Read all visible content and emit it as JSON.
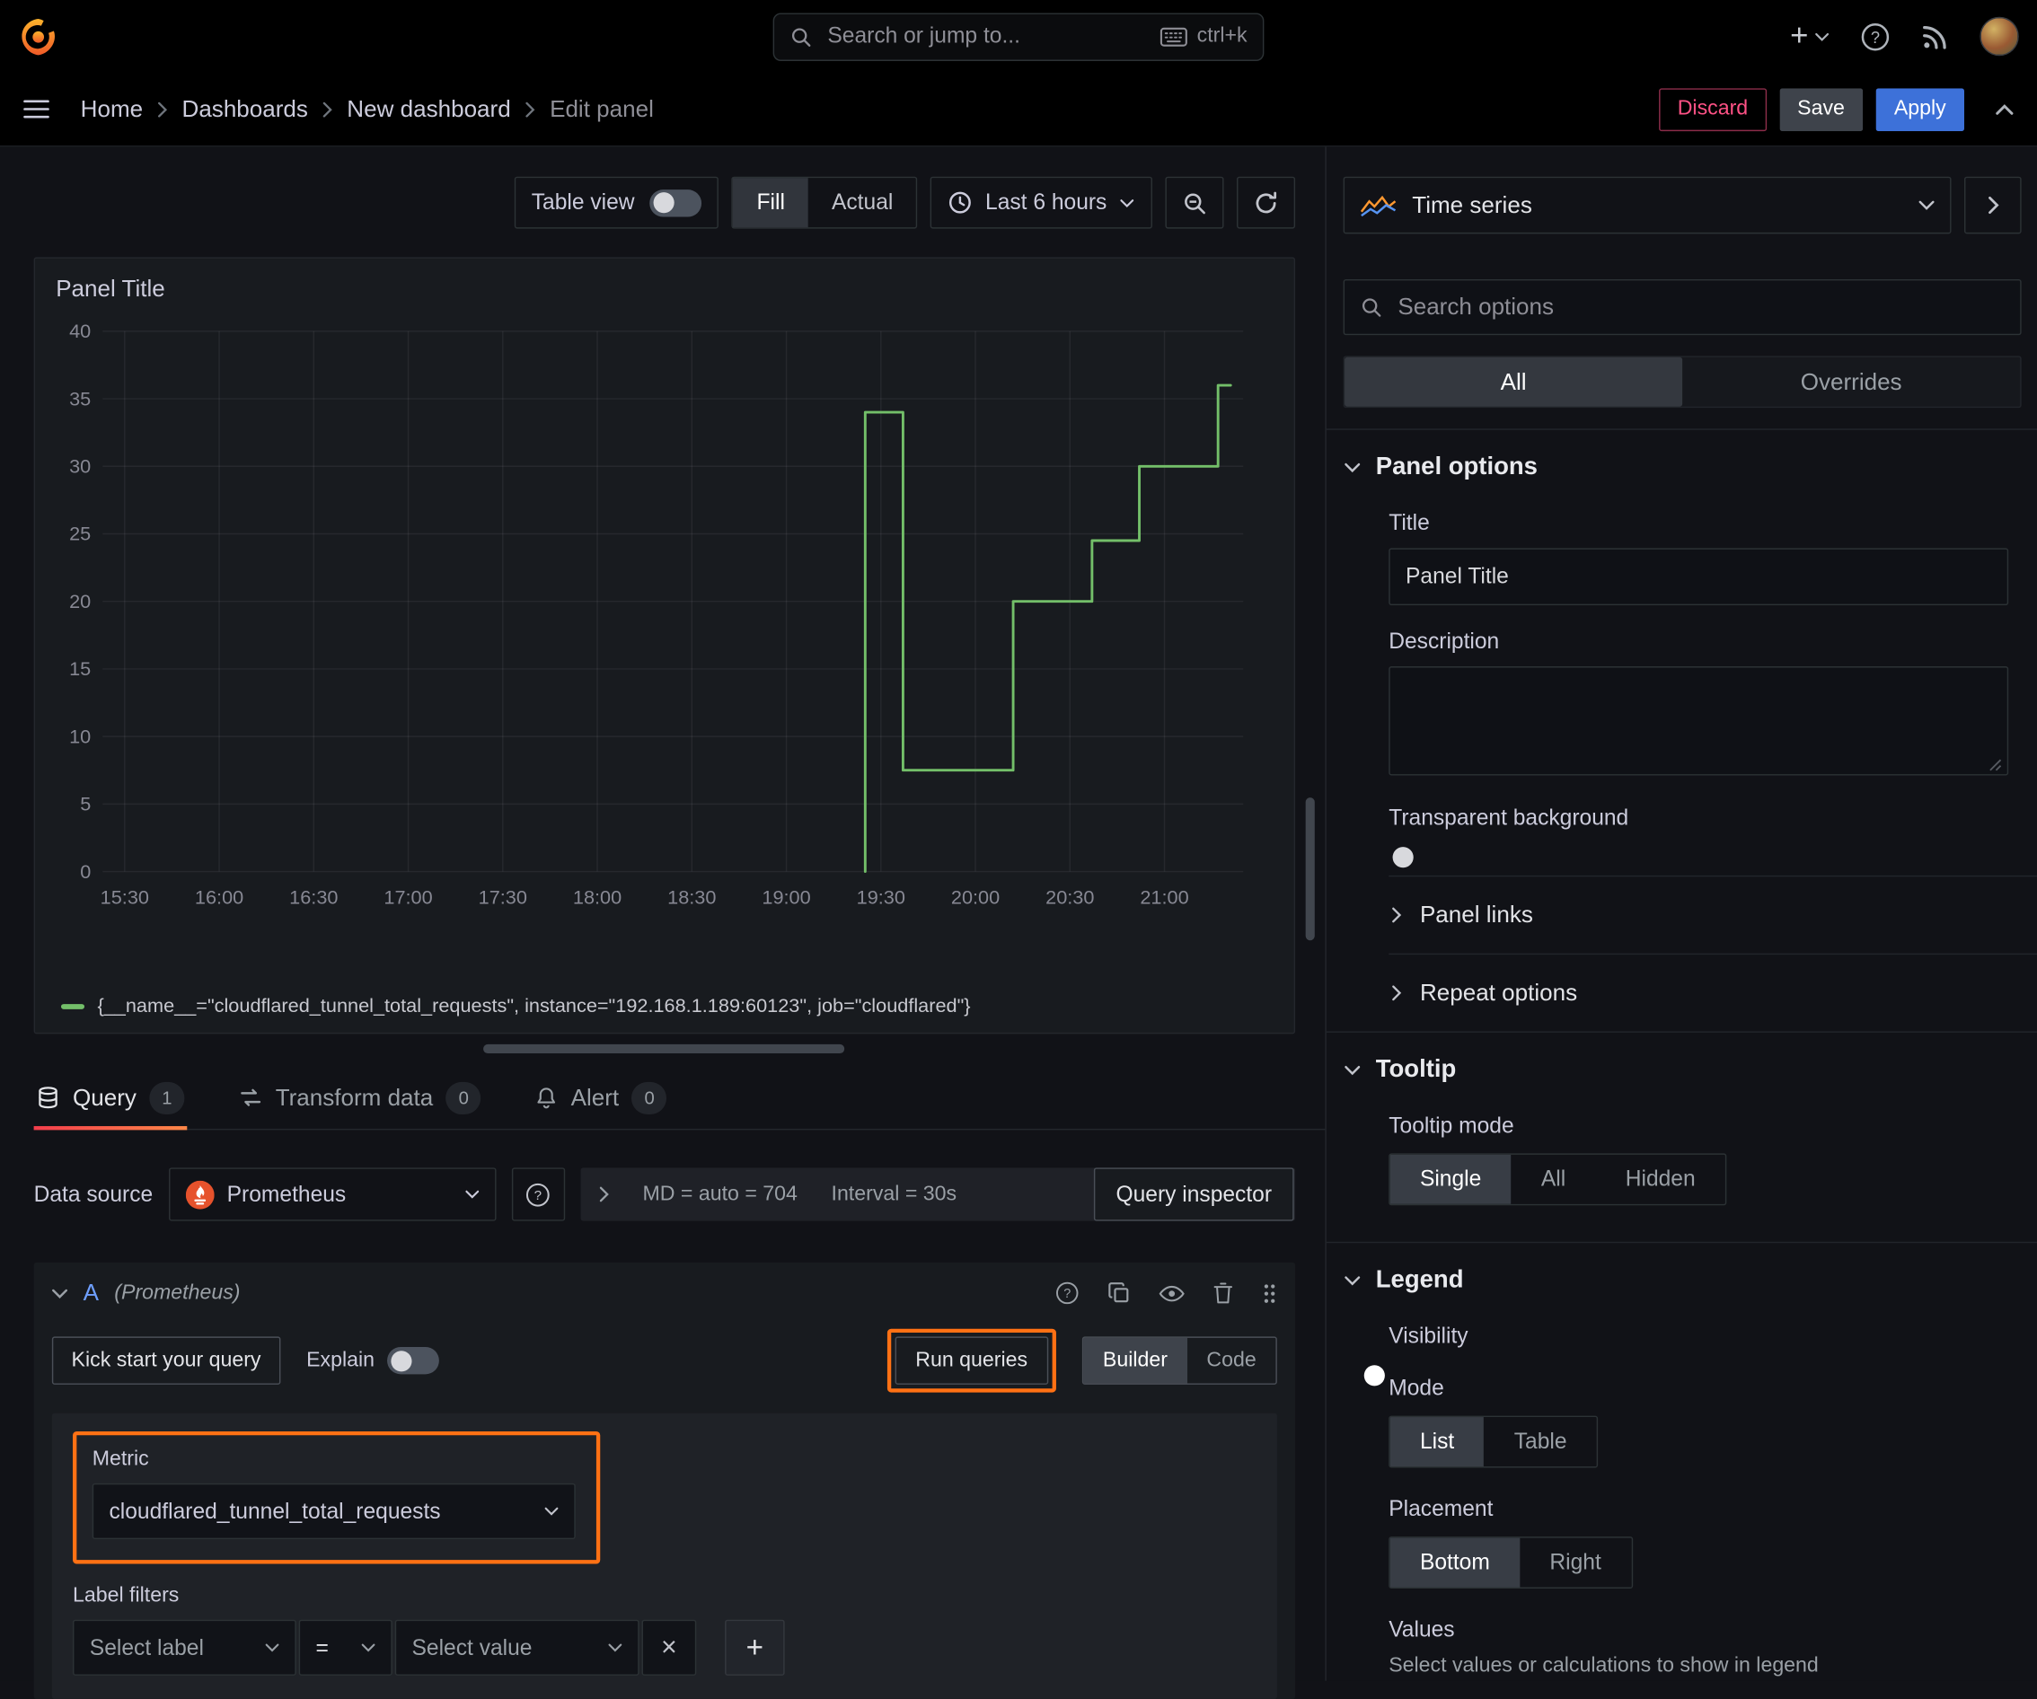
{
  "colors": {
    "accent_orange": "#ff7114",
    "apply_blue": "#3d71d9",
    "series_green": "#73bf69",
    "discard_pink": "#ff5286",
    "tab_underline": "#ff6a3a"
  },
  "topbar": {
    "search_placeholder": "Search or jump to...",
    "shortcut": "ctrl+k"
  },
  "breadcrumbs": [
    "Home",
    "Dashboards",
    "New dashboard",
    "Edit panel"
  ],
  "header_actions": {
    "discard": "Discard",
    "save": "Save",
    "apply": "Apply"
  },
  "toolbar": {
    "table_view_label": "Table view",
    "table_view_on": false,
    "display_modes": [
      "Fill",
      "Actual"
    ],
    "display_selected": "Fill",
    "time_range": "Last 6 hours"
  },
  "panel": {
    "title": "Panel Title"
  },
  "chart_data": {
    "type": "line",
    "line_style": "step",
    "title": "Panel Title",
    "xlabel": "",
    "ylabel": "",
    "x_range": [
      "15:23",
      "21:25"
    ],
    "xticks": [
      "15:30",
      "16:00",
      "16:30",
      "17:00",
      "17:30",
      "18:00",
      "18:30",
      "19:00",
      "19:30",
      "20:00",
      "20:30",
      "21:00"
    ],
    "ylim": [
      0,
      40
    ],
    "yticks": [
      0,
      5,
      10,
      15,
      20,
      25,
      30,
      35,
      40
    ],
    "grid": true,
    "legend_position": "bottom",
    "series": [
      {
        "name": "{__name__=\"cloudflared_tunnel_total_requests\", instance=\"192.168.1.189:60123\", job=\"cloudflared\"}",
        "color": "#73bf69",
        "points": [
          [
            "19:25",
            0
          ],
          [
            "19:25",
            34
          ],
          [
            "19:37",
            34
          ],
          [
            "19:37",
            7.5
          ],
          [
            "20:12",
            7.5
          ],
          [
            "20:12",
            20
          ],
          [
            "20:37",
            20
          ],
          [
            "20:37",
            24.5
          ],
          [
            "20:52",
            24.5
          ],
          [
            "20:52",
            30
          ],
          [
            "21:17",
            30
          ],
          [
            "21:17",
            36
          ],
          [
            "21:21",
            36
          ]
        ]
      }
    ]
  },
  "tabs": [
    {
      "label": "Query",
      "badge": "1",
      "active": true
    },
    {
      "label": "Transform data",
      "badge": "0",
      "active": false
    },
    {
      "label": "Alert",
      "badge": "0",
      "active": false
    }
  ],
  "datasource_bar": {
    "label": "Data source",
    "name": "Prometheus",
    "max_data_points": "MD = auto = 704",
    "interval": "Interval = 30s",
    "inspector_label": "Query inspector"
  },
  "query": {
    "ref_id": "A",
    "ds_hint": "(Prometheus)",
    "kickstart_label": "Kick start your query",
    "explain_label": "Explain",
    "explain_on": false,
    "run_label": "Run queries",
    "editor_modes": [
      "Builder",
      "Code"
    ],
    "editor_mode_selected": "Builder",
    "metric_label": "Metric",
    "metric_value": "cloudflared_tunnel_total_requests",
    "label_filters_label": "Label filters",
    "select_label_placeholder": "Select label",
    "operator": "=",
    "select_value_placeholder": "Select value"
  },
  "options_pane": {
    "visualization": "Time series",
    "search_placeholder": "Search options",
    "filter_tabs": [
      "All",
      "Overrides"
    ],
    "filter_selected": "All",
    "panel_options": {
      "heading": "Panel options",
      "title_label": "Title",
      "title_value": "Panel Title",
      "description_label": "Description",
      "description_value": "",
      "transparent_label": "Transparent background",
      "transparent_on": false
    },
    "collapsed_sections": [
      "Panel links",
      "Repeat options"
    ],
    "tooltip": {
      "heading": "Tooltip",
      "mode_label": "Tooltip mode",
      "modes": [
        "Single",
        "All",
        "Hidden"
      ],
      "selected": "Single"
    },
    "legend": {
      "heading": "Legend",
      "visibility_label": "Visibility",
      "visibility_on": true,
      "mode_label": "Mode",
      "modes": [
        "List",
        "Table"
      ],
      "mode_selected": "List",
      "placement_label": "Placement",
      "placements": [
        "Bottom",
        "Right"
      ],
      "placement_selected": "Bottom",
      "values_label": "Values",
      "values_description": "Select values or calculations to show in legend"
    }
  }
}
